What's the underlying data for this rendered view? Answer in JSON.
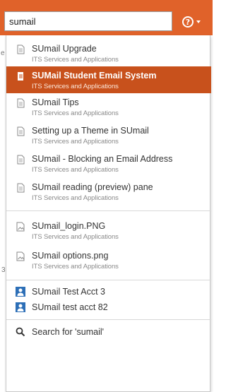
{
  "search": {
    "value": "sumail"
  },
  "help": {
    "glyph": "?"
  },
  "side_chars": [
    "e",
    "3"
  ],
  "pages": [
    {
      "title": "SUmail Upgrade",
      "sub": "ITS Services and Applications"
    },
    {
      "title": "SUMail Student Email System",
      "sub": "ITS Services and Applications"
    },
    {
      "title": "SUmail Tips",
      "sub": "ITS Services and Applications"
    },
    {
      "title": "Setting up a Theme in SUmail",
      "sub": "ITS Services and Applications"
    },
    {
      "title": "SUmail - Blocking an Email Address",
      "sub": "ITS Services and Applications"
    },
    {
      "title": "SUmail reading (preview) pane",
      "sub": "ITS Services and Applications"
    }
  ],
  "files": [
    {
      "title": "SUmail_login.PNG",
      "sub": "ITS Services and Applications"
    },
    {
      "title": "SUmail options.png",
      "sub": "ITS Services and Applications"
    }
  ],
  "users": [
    {
      "title": "SUmail Test Acct 3"
    },
    {
      "title": "SUmail test acct 82"
    }
  ],
  "search_for": {
    "label": "Search for 'sumail'"
  },
  "colors": {
    "header": "#e0622a",
    "highlight": "#c8511c",
    "user_icon": "#2d6fb7"
  }
}
